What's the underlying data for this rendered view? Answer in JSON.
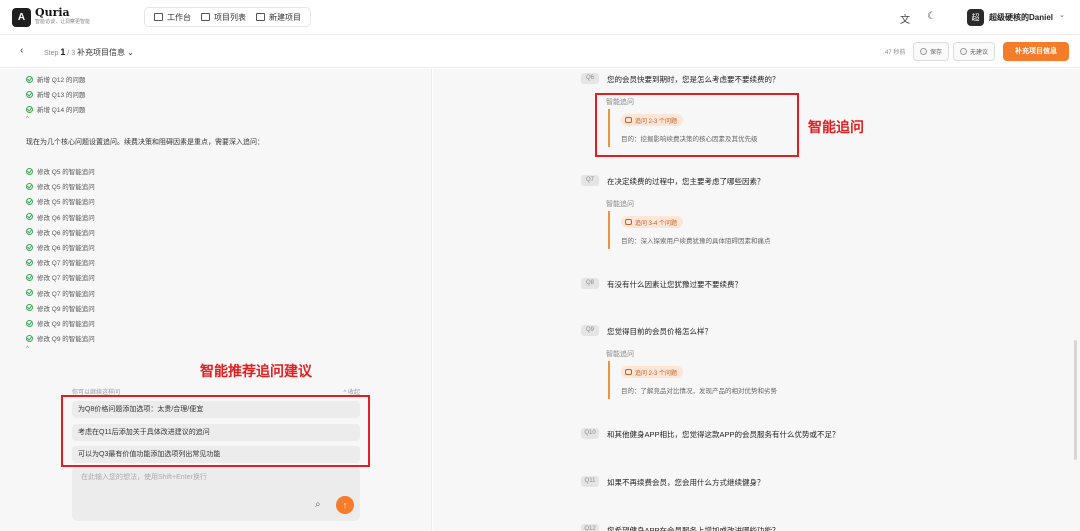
{
  "header": {
    "logo_glyph": "A",
    "brand_name": "Quria",
    "brand_tagline": "智能访谈，让洞察更智能",
    "nav": [
      {
        "label": "工作台",
        "icon": "grid-icon"
      },
      {
        "label": "项目列表",
        "icon": "folder-icon"
      },
      {
        "label": "新建项目",
        "icon": "chat-plus-icon"
      }
    ],
    "translate_glyph": "文",
    "theme_glyph": "☾",
    "avatar_text": "超",
    "user_name": "超级硬核的Daniel",
    "user_chevron": "⌄"
  },
  "subheader": {
    "back_glyph": "‹",
    "step_prefix": "Step",
    "step_current": "1",
    "step_total": "/ 3",
    "step_title": "补充项目信息 ⌄",
    "timer": "47 秒前",
    "save_label": "保存",
    "no_suggest_label": "无建议",
    "primary_label": "补充项目信息"
  },
  "left": {
    "log_top": [
      "新增 Q12 的问题",
      "新增 Q13 的问题",
      "新增 Q14 的问题"
    ],
    "caret": "^",
    "paragraph": "现在为几个核心问题设置追问。续费决策和阻碍因素是重点，需要深入追问：",
    "log_bottom": [
      "修改 Q5 的智能追问",
      "修改 Q5 的智能追问",
      "修改 Q5 的智能追问",
      "修改 Q6 的智能追问",
      "修改 Q6 的智能追问",
      "修改 Q6 的智能追问",
      "修改 Q7 的智能追问",
      "修改 Q7 的智能追问",
      "修改 Q7 的智能追问",
      "修改 Q9 的智能追问",
      "修改 Q9 的智能追问",
      "修改 Q9 的智能追问"
    ],
    "suggest_head": "你可以继续这样问",
    "suggest_collapse": "^ 收起",
    "suggestions": [
      "为Q8价格问题添加选项：太贵/合理/便宜",
      "考虑在Q11后添加关于具体改进建议的追问",
      "可以为Q3最有价值功能添加选项列出常见功能"
    ],
    "input_placeholder": "在此输入您的想法，使用Shift+Enter换行",
    "attach_glyph": "⌕",
    "send_glyph": "↑",
    "annotation": "智能推荐追问建议"
  },
  "right": {
    "annotation": "智能追问",
    "questions": [
      {
        "num": "Q6",
        "text": "您的会员快要到期时，您是怎么考虑要不要续费的？",
        "followup": {
          "label": "智能追问",
          "badge": "追问 2-3 个问题",
          "goal": "目的：挖掘影响续费决策的核心因素及其优先级"
        }
      },
      {
        "num": "Q7",
        "text": "在决定续费的过程中，您主要考虑了哪些因素？",
        "followup": {
          "label": "智能追问",
          "badge": "追问 3-4 个问题",
          "goal": "目的：深入探索用户续费犹豫的具体阻碍因素和痛点"
        }
      },
      {
        "num": "Q8",
        "text": "有没有什么因素让您犹豫过要不要续费？"
      },
      {
        "num": "Q9",
        "text": "您觉得目前的会员价格怎么样？",
        "followup": {
          "label": "智能追问",
          "badge": "追问 2-3 个问题",
          "goal": "目的：了解竞品对比情况，发现产品的相对优势和劣势"
        }
      },
      {
        "num": "Q10",
        "text": "和其他健身APP相比，您觉得这款APP的会员服务有什么优势或不足？"
      },
      {
        "num": "Q11",
        "text": "如果不再续费会员，您会用什么方式继续健身？"
      },
      {
        "num": "Q12",
        "text": "您希望健身APP在会员服务上增加或改进哪些功能？"
      }
    ]
  }
}
